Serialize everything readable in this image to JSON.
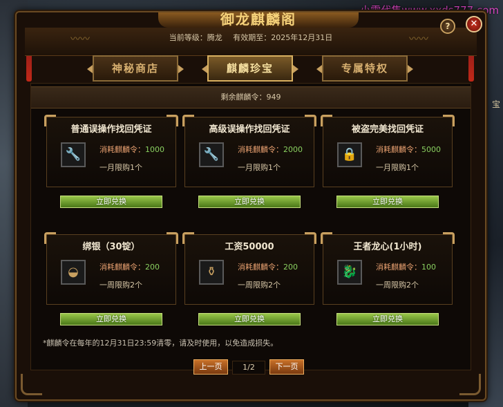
{
  "watermark": "小雪代售www.xxds777.com",
  "side_glyph": "宝",
  "window": {
    "title": "御龙麒麟阁",
    "header": {
      "level_label": "当前等级：腾龙",
      "expiry_label": "有效期至：2025年12月31日"
    },
    "help_label": "?",
    "close_label": "✕"
  },
  "tabs": [
    {
      "label": "神秘商店",
      "active": false
    },
    {
      "label": "麒麟珍宝",
      "active": true
    },
    {
      "label": "专属特权",
      "active": false
    }
  ],
  "remaining": "剩余麒麟令：949",
  "items": [
    {
      "title": "普通误操作找回凭证",
      "icon": "wrench-icon",
      "icon_glyph": "🔧",
      "cost_label": "消耗麒麟令：",
      "cost": "1000",
      "limit": "一月限购1个",
      "button": "立即兑换"
    },
    {
      "title": "高级误操作找回凭证",
      "icon": "wrench-icon",
      "icon_glyph": "🔧",
      "cost_label": "消耗麒麟令：",
      "cost": "2000",
      "limit": "一月限购1个",
      "button": "立即兑换"
    },
    {
      "title": "被盗完美找回凭证",
      "icon": "lock-icon",
      "icon_glyph": "🔒",
      "cost_label": "消耗麒麟令：",
      "cost": "5000",
      "limit": "一月限购1个",
      "button": "立即兑换"
    },
    {
      "title": "绑银（30锭）",
      "icon": "silver-ingot-icon",
      "icon_glyph": "◒",
      "cost_label": "消耗麒麟令：",
      "cost": "200",
      "limit": "一周限购2个",
      "button": "立即兑换"
    },
    {
      "title": "工资50000",
      "icon": "gold-jar-icon",
      "icon_glyph": "⚱",
      "cost_label": "消耗麒麟令：",
      "cost": "200",
      "limit": "一周限购2个",
      "button": "立即兑换"
    },
    {
      "title": "王者龙心(1小时)",
      "icon": "dragon-head-icon",
      "icon_glyph": "🐉",
      "cost_label": "消耗麒麟令：",
      "cost": "100",
      "limit": "一周限购2个",
      "button": "立即兑换"
    }
  ],
  "notice": "*麒麟令在每年的12月31日23:59清零，请及时使用，以免造成损失。",
  "pager": {
    "prev": "上一页",
    "page": "1/2",
    "next": "下一页"
  },
  "colors": {
    "accent_gold": "#c8a060",
    "cost_green": "#8ad060",
    "button_green": "#6aa030",
    "page_button_orange": "#c87028"
  }
}
